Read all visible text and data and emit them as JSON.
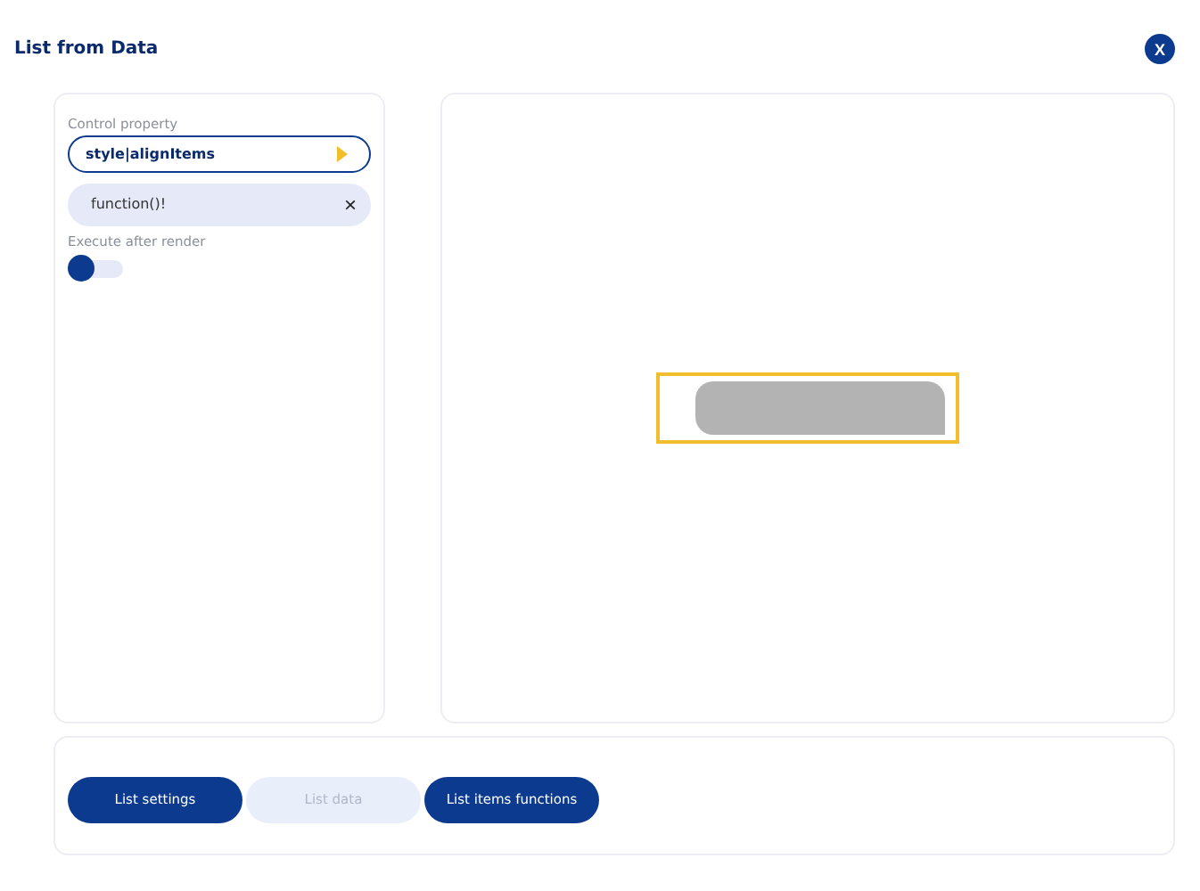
{
  "window": {
    "title": "List from Data",
    "close": "X"
  },
  "property": {
    "label": "Control property",
    "value": "style|alignItems"
  },
  "function_field": {
    "value": "function()!",
    "clear": "×"
  },
  "execute_after_render": {
    "label": "Execute after render",
    "on": false
  },
  "tabs": [
    {
      "label": "List settings",
      "selected": false
    },
    {
      "label": "List data",
      "selected": true
    },
    {
      "label": "List items functions",
      "selected": false
    }
  ]
}
